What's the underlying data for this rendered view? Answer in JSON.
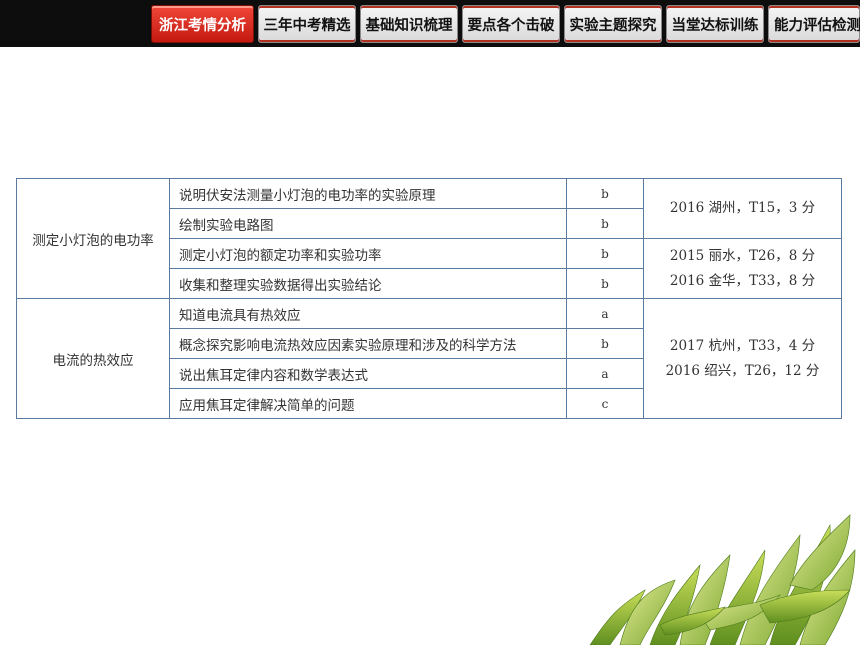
{
  "nav": {
    "tabs": [
      {
        "label": "浙江考情分析",
        "active": true
      },
      {
        "label": "三年中考精选",
        "active": false
      },
      {
        "label": "基础知识梳理",
        "active": false
      },
      {
        "label": "要点各个击破",
        "active": false
      },
      {
        "label": "实验主题探究",
        "active": false
      },
      {
        "label": "当堂达标训练",
        "active": false
      },
      {
        "label": "能力评估检测",
        "active": false
      }
    ]
  },
  "table": {
    "groups": [
      {
        "topic": "测定小灯泡的电功率",
        "rows": [
          {
            "requirement": "说明伏安法测量小灯泡的电功率的实验原理",
            "level": "b"
          },
          {
            "requirement": "绘制实验电路图",
            "level": "b"
          },
          {
            "requirement": "测定小灯泡的额定功率和实验功率",
            "level": "b"
          },
          {
            "requirement": "收集和整理实验数据得出实验结论",
            "level": "b"
          }
        ],
        "exams": [
          {
            "lines": [
              "2016 湖州，T15，3 分"
            ]
          },
          {
            "lines": [
              "2015 丽水，T26，8 分",
              "2016 金华，T33，8 分"
            ]
          }
        ]
      },
      {
        "topic": "电流的热效应",
        "rows": [
          {
            "requirement": "知道电流具有热效应",
            "level": "a"
          },
          {
            "requirement": "概念探究影响电流热效应因素实验原理和涉及的科学方法",
            "level": "b"
          },
          {
            "requirement": "说出焦耳定律内容和数学表达式",
            "level": "a"
          },
          {
            "requirement": "应用焦耳定律解决简单的问题",
            "level": "c"
          }
        ],
        "exams": [
          {
            "lines": [
              "2017 杭州，T33，4 分",
              "2016 绍兴，T26，12 分"
            ]
          }
        ]
      }
    ]
  },
  "colors": {
    "active_tab": "#d92a1c",
    "table_border": "#5a7aa0",
    "topbar": "#0d0d0d"
  }
}
